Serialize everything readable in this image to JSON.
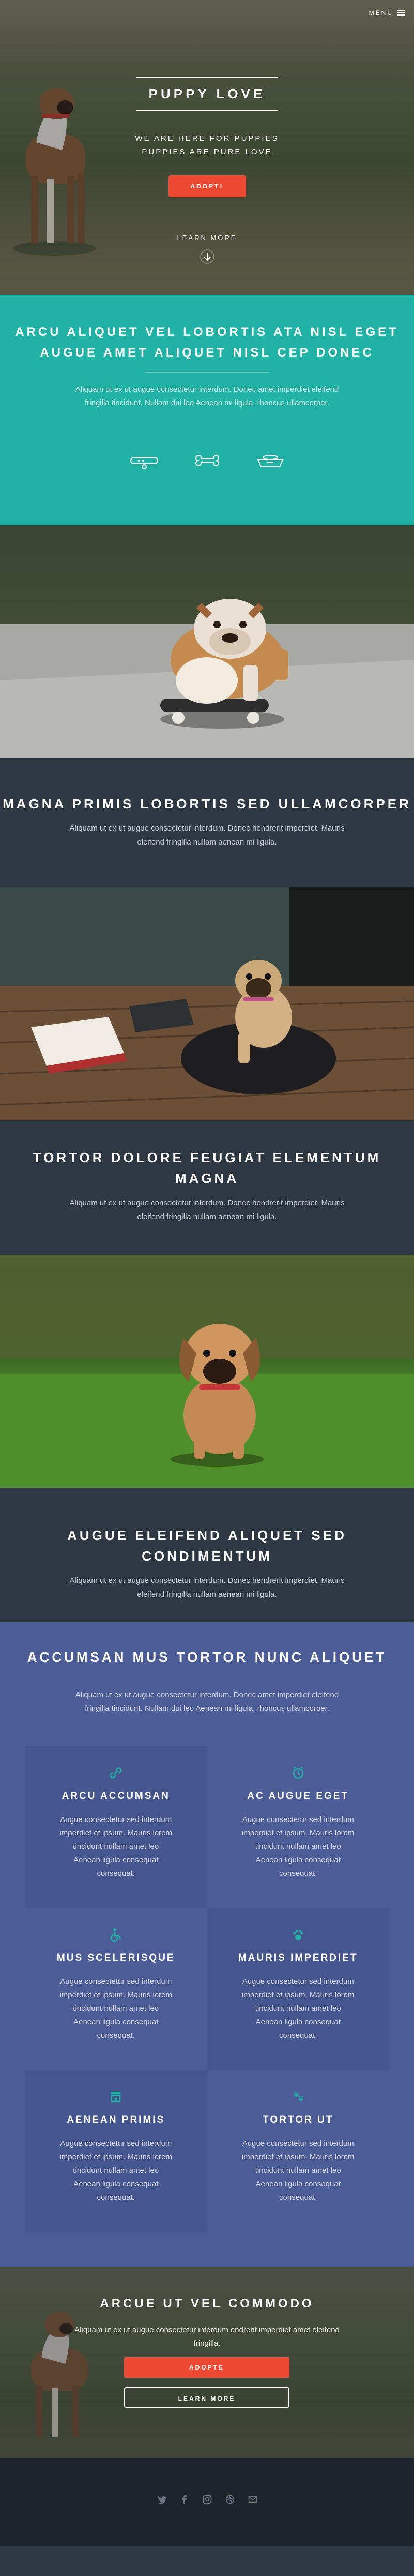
{
  "nav": {
    "menu_label": "MENU"
  },
  "hero": {
    "title": "PUPPY LOVE",
    "subtitle_line1": "WE ARE HERE FOR PUPPIES",
    "subtitle_line2": "PUPPIES ARE PURE LOVE",
    "cta_label": "ADOPT!",
    "learn_more_label": "LEARN MORE"
  },
  "banner": {
    "title_line1": "ARCU ALIQUET VEL LOBORTIS ATA NISL EGET",
    "title_line2": "AUGUE AMET ALIQUET NISL CEP DONEC",
    "text_line1": "Aliquam ut ex ut augue consectetur interdum. Donec amet imperdiet eleifend",
    "text_line2": "fringilla tincidunt. Nullam dui leo Aenean mi ligula, rhoncus ullamcorper.",
    "icons": [
      "collar-icon",
      "bone-icon",
      "food-bowl-icon"
    ]
  },
  "spotlights": [
    {
      "title_line1": "MAGNA PRIMIS LOBORTIS SED ULLAMCORPER",
      "title_line2": "",
      "text_line1": "Aliquam ut ex ut augue consectetur interdum. Donec hendrerit imperdiet. Mauris",
      "text_line2": "eleifend fringilla nullam aenean mi ligula."
    },
    {
      "title_line1": "TORTOR DOLORE FEUGIAT ELEMENTUM",
      "title_line2": "MAGNA",
      "text_line1": "Aliquam ut ex ut augue consectetur interdum. Donec hendrerit imperdiet. Mauris",
      "text_line2": "eleifend fringilla nullam aenean mi ligula."
    },
    {
      "title_line1": "AUGUE ELEIFEND ALIQUET SED CONDIMENTUM",
      "title_line2": "",
      "text_line1": "Aliquam ut ex ut augue consectetur interdum. Donec hendrerit imperdiet. Mauris",
      "text_line2": "eleifend fringilla nullam aenean mi ligula."
    }
  ],
  "features": {
    "title": "ACCUMSAN MUS TORTOR NUNC ALIQUET",
    "text_line1": "Aliquam ut ex ut augue consectetur interdum. Donec amet imperdiet eleifend",
    "text_line2": "fringilla tincidunt. Nullam dui leo Aenean mi ligula, rhoncus ullamcorper.",
    "items": [
      {
        "title": "ARCU ACCUMSAN",
        "icon": "link-icon",
        "l1": "Augue consectetur sed interdum",
        "l2": "imperdiet et ipsum. Mauris lorem",
        "l3": "tincidunt nullam amet leo",
        "l4": "Aenean ligula consequat",
        "l5": "consequat."
      },
      {
        "title": "AC AUGUE EGET",
        "icon": "alarm-icon",
        "l1": "Augue consectetur sed interdum",
        "l2": "imperdiet et ipsum. Mauris lorem",
        "l3": "tincidunt nullam amet leo",
        "l4": "Aenean ligula consequat",
        "l5": "consequat."
      },
      {
        "title": "MUS SCELERISQUE",
        "icon": "wheelchair-icon",
        "l1": "Augue consectetur sed interdum",
        "l2": "imperdiet et ipsum. Mauris lorem",
        "l3": "tincidunt nullam amet leo",
        "l4": "Aenean ligula consequat",
        "l5": "consequat."
      },
      {
        "title": "MAURIS IMPERDIET",
        "icon": "paw-icon",
        "l1": "Augue consectetur sed interdum",
        "l2": "imperdiet et ipsum. Mauris lorem",
        "l3": "tincidunt nullam amet leo",
        "l4": "Aenean ligula consequat",
        "l5": "consequat."
      },
      {
        "title": "AENEAN PRIMIS",
        "icon": "shop-icon",
        "l1": "Augue consectetur sed interdum",
        "l2": "imperdiet et ipsum. Mauris lorem",
        "l3": "tincidunt nullam amet leo",
        "l4": "Aenean ligula consequat",
        "l5": "consequat."
      },
      {
        "title": "TORTOR UT",
        "icon": "paw-print-icon",
        "l1": "Augue consectetur sed interdum",
        "l2": "imperdiet et ipsum. Mauris lorem",
        "l3": "tincidunt nullam amet leo",
        "l4": "Aenean ligula consequat",
        "l5": "consequat."
      }
    ]
  },
  "cta": {
    "title": "ARCUE UT VEL COMMODO",
    "text_line1": "Aliquam ut ex ut augue consectetur interdum endrerit imperdiet amet eleifend",
    "text_line2": "fringilla.",
    "primary_label": "ADOPTE",
    "secondary_label": "LEARN MORE"
  },
  "footer": {
    "socials": [
      "twitter-icon",
      "facebook-icon",
      "instagram-icon",
      "dribbble-icon",
      "email-icon"
    ]
  },
  "colors": {
    "teal": "#21b2a6",
    "dark": "#2e3842",
    "indigo": "#4c5c96",
    "red": "#ed4933",
    "footer": "#1d242a"
  }
}
